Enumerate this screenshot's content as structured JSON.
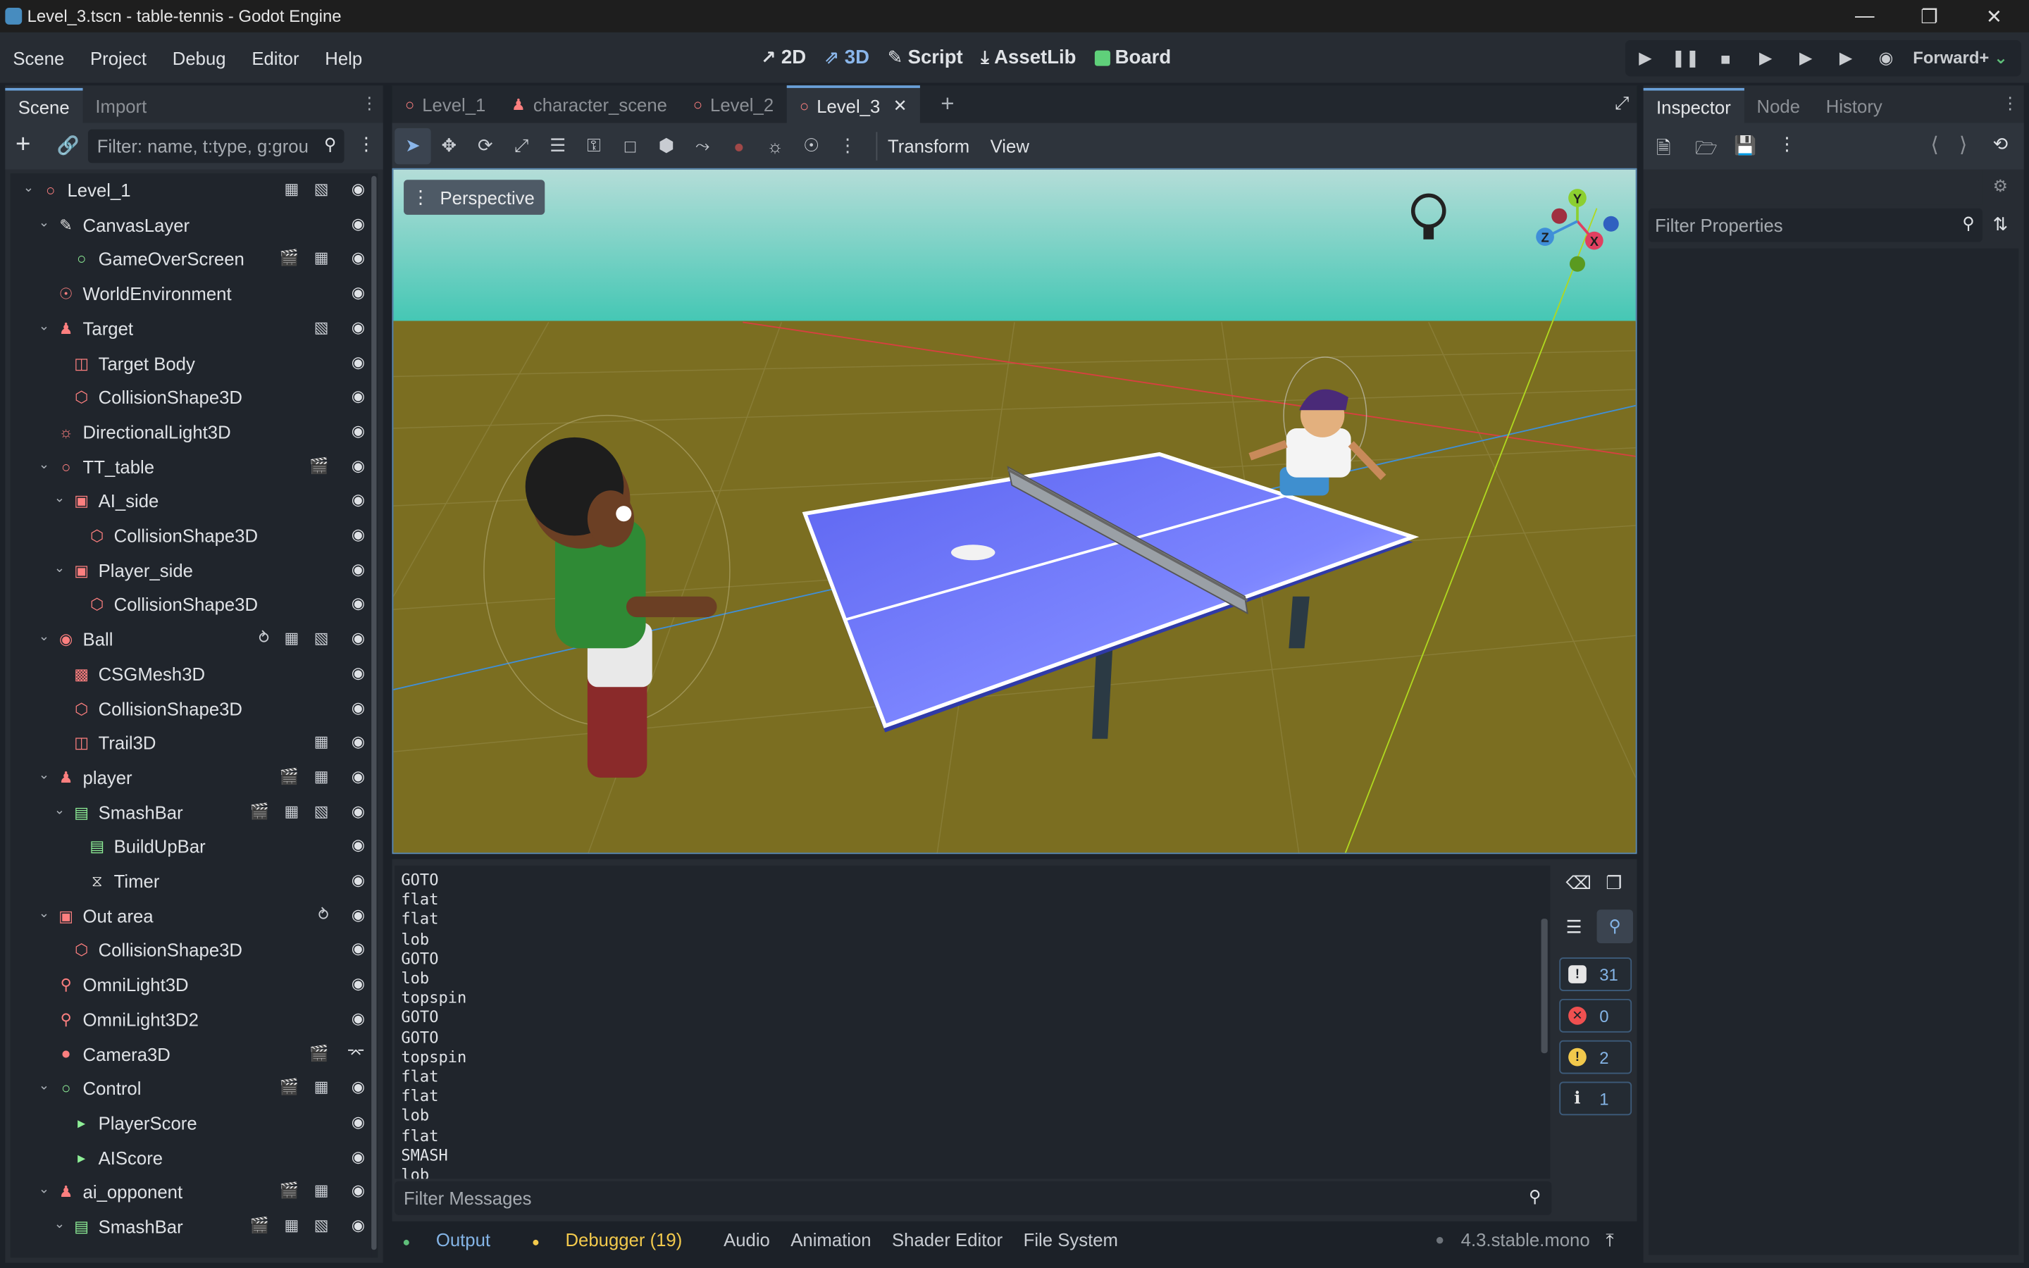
{
  "window": {
    "title": "Level_3.tscn - table-tennis - Godot Engine"
  },
  "menu": [
    "Scene",
    "Project",
    "Debug",
    "Editor",
    "Help"
  ],
  "modes": [
    {
      "label": "2D",
      "icon": "2d-icon"
    },
    {
      "label": "3D",
      "icon": "3d-icon",
      "active": true
    },
    {
      "label": "Script",
      "icon": "script-icon"
    },
    {
      "label": "AssetLib",
      "icon": "assetlib-icon"
    },
    {
      "label": "Board",
      "icon": "board-icon"
    }
  ],
  "renderer": "Forward+",
  "scene_dock": {
    "tabs": [
      "Scene",
      "Import"
    ],
    "filter_placeholder": "Filter: name, t:type, g:grou",
    "nodes": [
      {
        "label": "Level_1",
        "depth": 0,
        "icon": "node3d-icon",
        "icon_color": "#fc7f7f",
        "expanded": true
      },
      {
        "label": "CanvasLayer",
        "depth": 1,
        "icon": "canvaslayer-icon",
        "icon_color": "#e0e0e0",
        "expanded": true
      },
      {
        "label": "GameOverScreen",
        "depth": 2,
        "icon": "control-icon",
        "icon_color": "#8eef97"
      },
      {
        "label": "WorldEnvironment",
        "depth": 1,
        "icon": "world-environment-icon",
        "icon_color": "#fc7f7f"
      },
      {
        "label": "Target",
        "depth": 1,
        "icon": "characterbody-icon",
        "icon_color": "#fc7f7f",
        "expanded": true
      },
      {
        "label": "Target Body",
        "depth": 2,
        "icon": "meshinstance-icon",
        "icon_color": "#fc7f7f"
      },
      {
        "label": "CollisionShape3D",
        "depth": 2,
        "icon": "collisionshape-icon",
        "icon_color": "#fc7f7f"
      },
      {
        "label": "DirectionalLight3D",
        "depth": 1,
        "icon": "directional-light-icon",
        "icon_color": "#fc7f7f"
      },
      {
        "label": "TT_table",
        "depth": 1,
        "icon": "node3d-icon",
        "icon_color": "#fc7f7f",
        "expanded": true
      },
      {
        "label": "AI_side",
        "depth": 2,
        "icon": "area3d-icon",
        "icon_color": "#fc7f7f",
        "expanded": true
      },
      {
        "label": "CollisionShape3D",
        "depth": 3,
        "icon": "collisionshape-icon",
        "icon_color": "#fc7f7f"
      },
      {
        "label": "Player_side",
        "depth": 2,
        "icon": "area3d-icon",
        "icon_color": "#fc7f7f",
        "expanded": true
      },
      {
        "label": "CollisionShape3D",
        "depth": 3,
        "icon": "collisionshape-icon",
        "icon_color": "#fc7f7f"
      },
      {
        "label": "Ball",
        "depth": 1,
        "icon": "rigidbody-icon",
        "icon_color": "#fc7f7f",
        "expanded": true
      },
      {
        "label": "CSGMesh3D",
        "depth": 2,
        "icon": "csgmesh-icon",
        "icon_color": "#fc7f7f"
      },
      {
        "label": "CollisionShape3D",
        "depth": 2,
        "icon": "collisionshape-icon",
        "icon_color": "#fc7f7f"
      },
      {
        "label": "Trail3D",
        "depth": 2,
        "icon": "meshinstance-icon",
        "icon_color": "#fc7f7f"
      },
      {
        "label": "player",
        "depth": 1,
        "icon": "characterbody-icon",
        "icon_color": "#fc7f7f",
        "expanded": true
      },
      {
        "label": "SmashBar",
        "depth": 2,
        "icon": "progressbar-icon",
        "icon_color": "#8eef97",
        "expanded": true
      },
      {
        "label": "BuildUpBar",
        "depth": 3,
        "icon": "progressbar-icon",
        "icon_color": "#8eef97"
      },
      {
        "label": "Timer",
        "depth": 3,
        "icon": "timer-icon",
        "icon_color": "#e0e0e0"
      },
      {
        "label": "Out area",
        "depth": 1,
        "icon": "area3d-icon",
        "icon_color": "#fc7f7f",
        "expanded": true
      },
      {
        "label": "CollisionShape3D",
        "depth": 2,
        "icon": "collisionshape-icon",
        "icon_color": "#fc7f7f"
      },
      {
        "label": "OmniLight3D",
        "depth": 1,
        "icon": "omnilight-icon",
        "icon_color": "#fc7f7f"
      },
      {
        "label": "OmniLight3D2",
        "depth": 1,
        "icon": "omnilight-icon",
        "icon_color": "#fc7f7f"
      },
      {
        "label": "Camera3D",
        "depth": 1,
        "icon": "camera-icon",
        "icon_color": "#fc7f7f"
      },
      {
        "label": "Control",
        "depth": 1,
        "icon": "control-icon",
        "icon_color": "#8eef97",
        "expanded": true
      },
      {
        "label": "PlayerScore",
        "depth": 2,
        "icon": "label-icon",
        "icon_color": "#8eef97"
      },
      {
        "label": "AIScore",
        "depth": 2,
        "icon": "label-icon",
        "icon_color": "#8eef97"
      },
      {
        "label": "ai_opponent",
        "depth": 1,
        "icon": "characterbody-icon",
        "icon_color": "#fc7f7f",
        "expanded": true
      },
      {
        "label": "SmashBar",
        "depth": 2,
        "icon": "progressbar-icon",
        "icon_color": "#8eef97",
        "expanded": true
      }
    ]
  },
  "scene_tabs": [
    "Level_1",
    "character_scene",
    "Level_2",
    "Level_3"
  ],
  "active_scene_tab": "Level_3",
  "viewport_toolbar": {
    "transform": "Transform",
    "view": "View"
  },
  "viewport": {
    "perspective_label": "Perspective",
    "gizmo_axes": [
      "Y",
      "X",
      "Z"
    ]
  },
  "console": {
    "lines": [
      "GOTO",
      "flat",
      "flat",
      "lob",
      "GOTO",
      "lob",
      "topspin",
      "GOTO",
      "GOTO",
      "topspin",
      "flat",
      "flat",
      "lob",
      "flat",
      "SMASH",
      "lob"
    ],
    "filter_placeholder": "Filter Messages",
    "counts": {
      "messages": "31",
      "errors": "0",
      "warnings": "2",
      "info": "1"
    }
  },
  "bottom_tabs": [
    "Output",
    "Debugger (19)",
    "Audio",
    "Animation",
    "Shader Editor",
    "File System"
  ],
  "version": "4.3.stable.mono",
  "inspector": {
    "tabs": [
      "Inspector",
      "Node",
      "History"
    ],
    "filter_placeholder": "Filter Properties"
  }
}
